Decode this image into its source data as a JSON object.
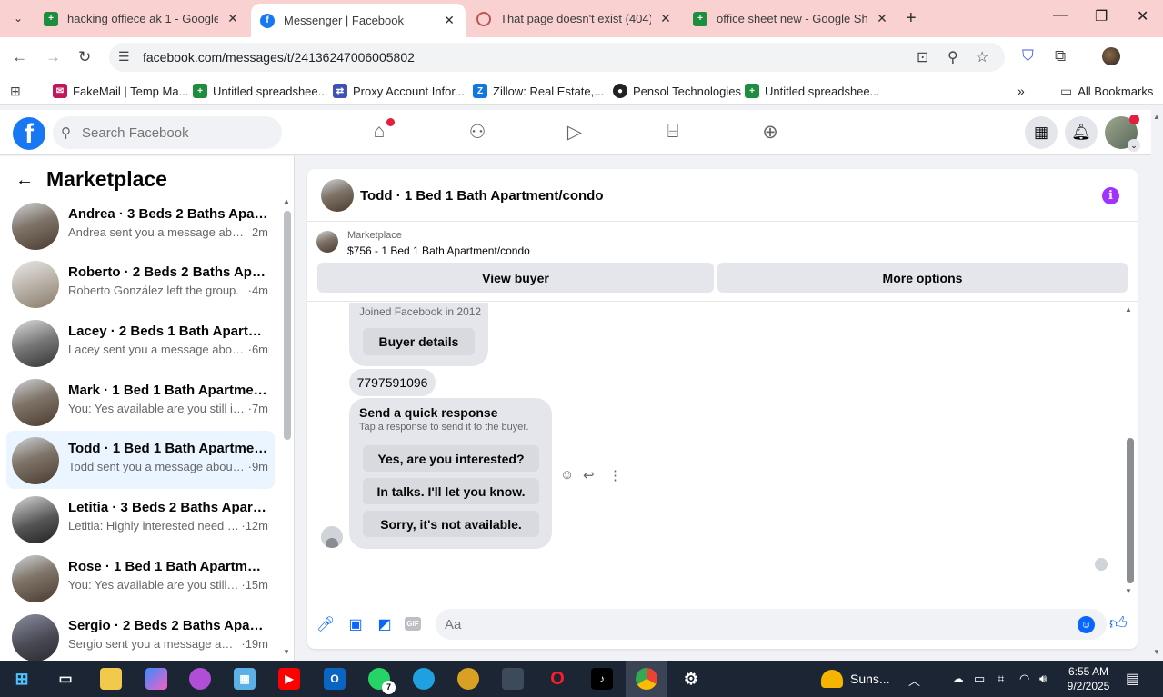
{
  "browser": {
    "tabs": [
      {
        "title": "hacking offiece ak 1 - Google Sh",
        "favicon": "google-sheets-icon",
        "active": false
      },
      {
        "title": "Messenger | Facebook",
        "favicon": "facebook-icon",
        "active": true
      },
      {
        "title": "That page doesn't exist (404) - I",
        "favicon": "error-page-icon",
        "active": false
      },
      {
        "title": "office sheet new - Google Shee",
        "favicon": "google-sheets-icon",
        "active": false
      }
    ],
    "url": "facebook.com/messages/t/24136247006005802",
    "bookmarks": [
      {
        "label": "FakeMail | Temp Ma...",
        "icon": "fakemail-icon"
      },
      {
        "label": "Untitled spreadshee...",
        "icon": "google-sheets-icon"
      },
      {
        "label": "Proxy Account Infor...",
        "icon": "proxy-icon"
      },
      {
        "label": "Zillow: Real Estate,...",
        "icon": "zillow-icon"
      },
      {
        "label": "Pensol Technologies",
        "icon": "pensol-icon"
      },
      {
        "label": "Untitled spreadshee...",
        "icon": "google-sheets-icon"
      }
    ],
    "all_bookmarks": "All Bookmarks"
  },
  "fb": {
    "search_placeholder": "Search Facebook"
  },
  "marketplace": {
    "title": "Marketplace",
    "conversations": [
      {
        "title": "Andrea · 3 Beds 2 Baths Apartm...",
        "msg": "Andrea sent you a message about ...",
        "time": "2m",
        "selected": false
      },
      {
        "title": "Roberto · 2 Beds 2 Baths Apart...",
        "msg": "Roberto González left the group.",
        "time": "·4m",
        "selected": false
      },
      {
        "title": "Lacey · 2 Beds 1 Bath Apartment...",
        "msg": "Lacey sent you a message about y...",
        "time": "·6m",
        "selected": false
      },
      {
        "title": "Mark · 1 Bed 1 Bath Apartment/...",
        "msg": "You: Yes available are you still inter...",
        "time": "·7m",
        "selected": false
      },
      {
        "title": "Todd · 1 Bed 1 Bath Apartment/c...",
        "msg": "Todd sent you a message about y...",
        "time": "·9m",
        "selected": true
      },
      {
        "title": "Letitia · 3 Beds 2 Baths Apartme...",
        "msg": "Letitia: Highly interested need to ...",
        "time": "·12m",
        "selected": false
      },
      {
        "title": "Rose · 1 Bed 1 Bath Apartment/c...",
        "msg": "You: Yes available are you still int...",
        "time": "·15m",
        "selected": false
      },
      {
        "title": "Sergio · 2 Beds 2 Baths Apartme...",
        "msg": "Sergio sent you a message about...",
        "time": "·19m",
        "selected": false
      }
    ]
  },
  "chat": {
    "title": "Todd · 1 Bed 1 Bath Apartment/condo",
    "listing_source": "Marketplace",
    "listing_price": "$756 - 1 Bed 1 Bath Apartment/condo",
    "view_buyer": "View buyer",
    "more_options": "More options",
    "joined": "Joined Facebook in 2012",
    "buyer_details": "Buyer details",
    "phone": "7797591096",
    "quick_title": "Send a quick response",
    "quick_sub": "Tap a response to send it to the buyer.",
    "quick_options": [
      "Yes, are you interested?",
      "In talks. I'll let you know.",
      "Sorry, it's not available."
    ],
    "input_placeholder": "Aa"
  },
  "taskbar": {
    "weather": "Suns...",
    "time": "6:55 AM",
    "date": "9/2/2025",
    "whatsapp_badge": "7"
  }
}
